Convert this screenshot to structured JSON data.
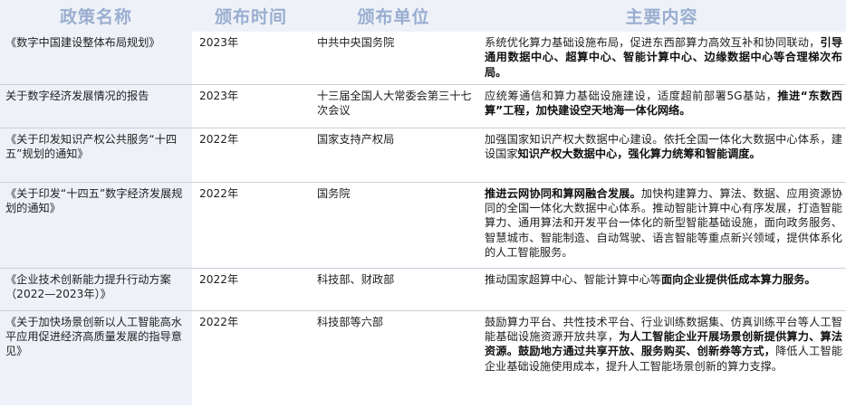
{
  "headers": [
    "政策名称",
    "颁布时间",
    "颁布单位",
    "主要内容"
  ],
  "rows": [
    {
      "name": "《数字中国建设整体布局规划》",
      "year": "2023年",
      "issuer": "中共中央国务院",
      "content": [
        {
          "t": "系统优化算力基础设施布局，促进东西部算力高效互补和协同联动，",
          "b": false
        },
        {
          "t": "引导通用数据中心、超算中心、智能计算中心、边缘数据中心等合理梯次布局。",
          "b": true
        }
      ]
    },
    {
      "name": "关于数字经济发展情况的报告",
      "year": "2023年",
      "issuer": "十三届全国人大常委会第三十七次会议",
      "content": [
        {
          "t": "应统筹通信和算力基础设施建设，适度超前部署5G基站，",
          "b": false
        },
        {
          "t": "推进“东数西算”工程，加快建设空天地海一体化网络。",
          "b": true
        }
      ]
    },
    {
      "name": "《关于印发知识产权公共服务“十四五”规划的通知》",
      "year": "2022年",
      "issuer": "国家支持产权局",
      "content": [
        {
          "t": "加强国家知识产权大数据中心建设。依托全国一体化大数据中心体系，建设国家",
          "b": false
        },
        {
          "t": "知识产权大数据中心，强化算力统筹和智能调度。",
          "b": true
        }
      ]
    },
    {
      "name": "《关于印发“十四五”数字经济发展规划的通知》",
      "year": "2022年",
      "issuer": "国务院",
      "content": [
        {
          "t": "推进云网协同和算网融合发展。",
          "b": true
        },
        {
          "t": "加快构建算力、算法、数据、应用资源协同的全国一体化大数据中心体系。推动智能计算中心有序发展，打造智能算力、通用算法和开发平台一体化的新型智能基础设施，面向政务服务、智慧城市、智能制造、自动驾驶、语言智能等重点新兴领域，提供体系化的人工智能服务。",
          "b": false
        }
      ]
    },
    {
      "name": "《企业技术创新能力提升行动方案（2022—2023年）》",
      "year": "2022年",
      "issuer": "科技部、财政部",
      "content": [
        {
          "t": "推动国家超算中心、智能计算中心等",
          "b": false
        },
        {
          "t": "面向企业提供低成本算力服务。",
          "b": true
        }
      ]
    },
    {
      "name": "《关于加快场景创新以人工智能高水平应用促进经济高质量发展的指导意见》",
      "year": "2022年",
      "issuer": "科技部等六部",
      "content": [
        {
          "t": "鼓励算力平台、共性技术平台、行业训练数据集、仿真训练平台等人工智能基础设施资源开放共享，",
          "b": false
        },
        {
          "t": "为人工智能企业开展场景创新提供算力、算法资源。鼓励地方通过共享开放、服务购买、创新券等方式，",
          "b": true
        },
        {
          "t": "降低人工智能企业基础设施使用成本，提升人工智能场景创新的算力支撑。",
          "b": false
        }
      ]
    }
  ]
}
